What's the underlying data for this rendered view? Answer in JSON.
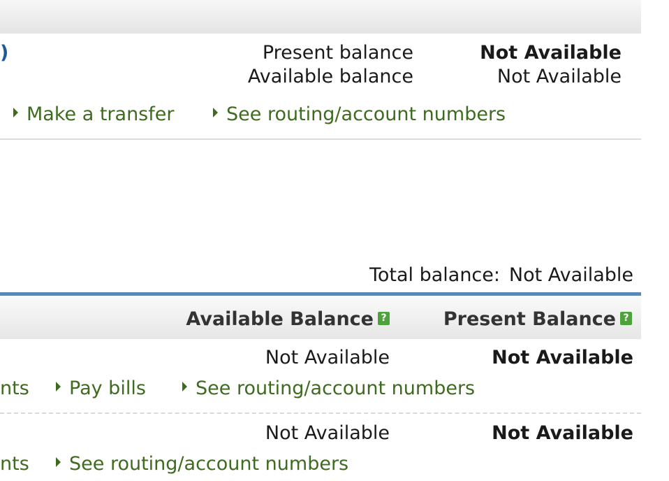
{
  "account1": {
    "name_tail": ")",
    "present_balance_label": "Present balance",
    "present_balance_value": "Not Available",
    "available_balance_label": "Available balance",
    "available_balance_value": "Not Available",
    "links": {
      "transfer": "Make a transfer",
      "routing": "See routing/account numbers"
    }
  },
  "summary": {
    "total_label": "Total balance:",
    "total_value": "Not Available"
  },
  "table": {
    "headers": {
      "available": "Available Balance",
      "present": "Present Balance",
      "help_glyph": "?"
    },
    "rows": [
      {
        "available": "Not Available",
        "present": "Not Available",
        "links": [
          "nts",
          "Pay bills",
          "See routing/account numbers"
        ]
      },
      {
        "available": "Not Available",
        "present": "Not Available",
        "links": [
          "nts",
          "See routing/account numbers"
        ]
      }
    ]
  },
  "colors": {
    "link": "#3e6b20",
    "accent_bar": "#5a87b8",
    "help_icon": "#4ea23c",
    "account_name": "#1e5a9a"
  }
}
